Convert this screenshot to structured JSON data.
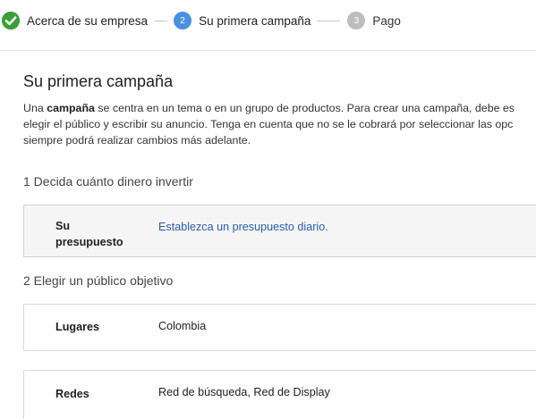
{
  "stepper": {
    "steps": [
      {
        "label": "Acerca de su empresa",
        "number": "",
        "state": "done",
        "icon": "check-icon"
      },
      {
        "label": "Su primera campaña",
        "number": "2",
        "state": "current"
      },
      {
        "label": "Pago",
        "number": "3",
        "state": "upcoming"
      }
    ]
  },
  "colors": {
    "done": "#3c9e37",
    "current": "#4a90e2",
    "upcoming": "#bdbdbd",
    "link": "#2a5db0"
  },
  "main": {
    "title": "Su primera campaña",
    "intro": {
      "line1_pre": "Una ",
      "line1_bold": "campaña",
      "line1_post": " se centra en un tema o en un grupo de productos. Para crear una campaña, debe es",
      "line2": "elegir el público y escribir su anuncio. Tenga en cuenta que no se le cobrará por seleccionar las opc",
      "line3": "siempre podrá realizar cambios más adelante."
    },
    "section1": {
      "heading": "1 Decida cuánto dinero invertir",
      "budget_label_line1": "Su",
      "budget_label_line2": "presupuesto",
      "budget_link": "Establezca un presupuesto diario."
    },
    "section2": {
      "heading": "2 Elegir un público objetivo",
      "locations_label": "Lugares",
      "locations_value": "Colombia",
      "networks_label": "Redes",
      "networks_value": "Red de búsqueda, Red de Display"
    }
  }
}
